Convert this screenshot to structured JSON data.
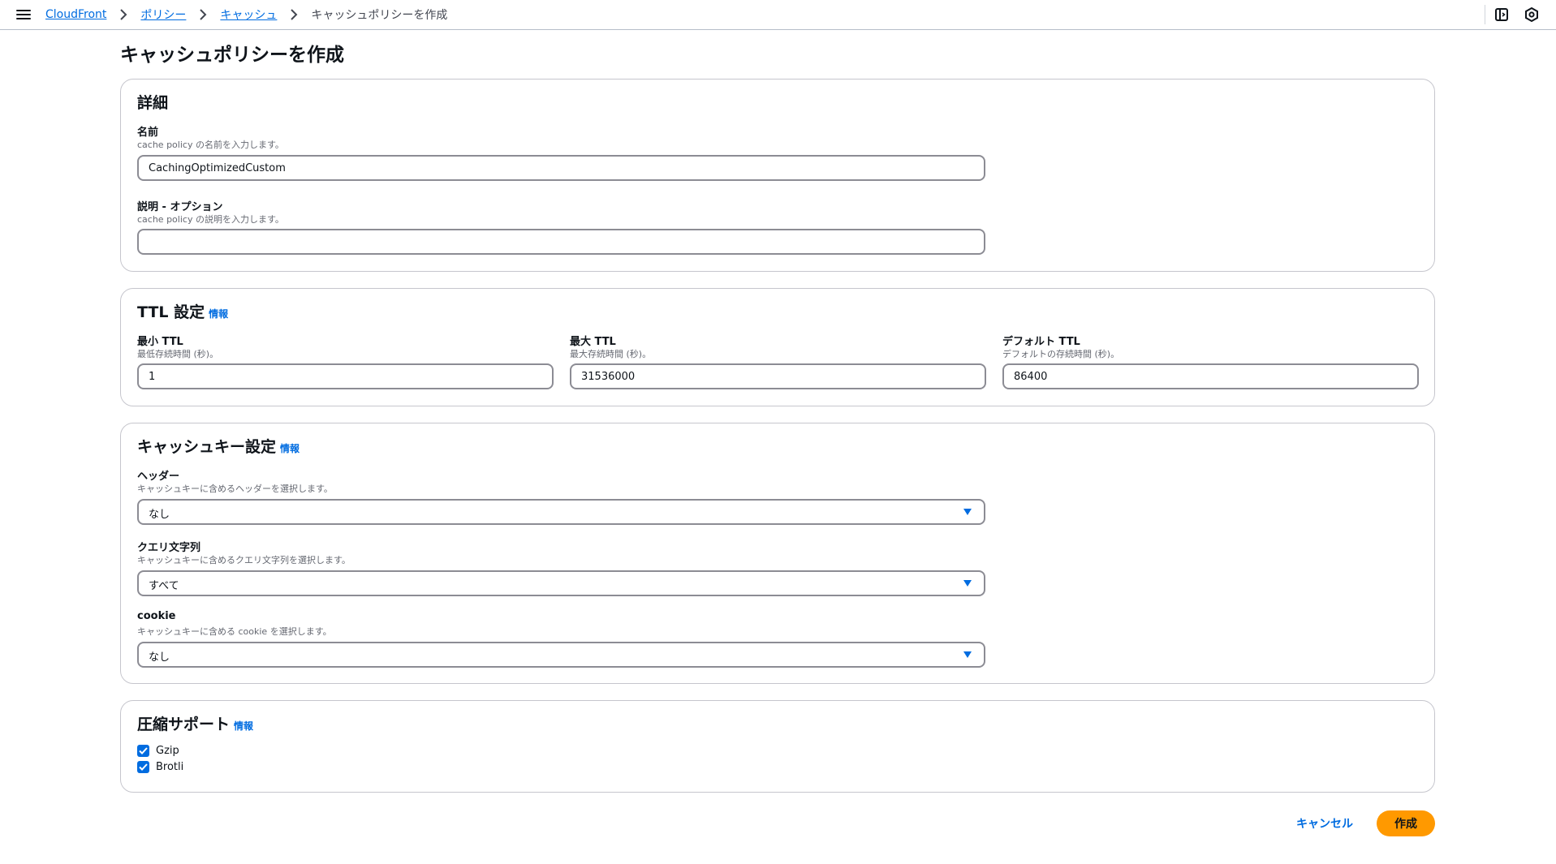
{
  "breadcrumb": {
    "items": [
      "CloudFront",
      "ポリシー",
      "キャッシュ"
    ],
    "current": "キャッシュポリシーを作成"
  },
  "page_title": "キャッシュポリシーを作成",
  "details": {
    "heading": "詳細",
    "name_label": "名前",
    "name_desc": "cache policy の名前を入力します。",
    "name_value": "CachingOptimizedCustom",
    "description_label": "説明 - オプション",
    "description_desc": "cache policy の説明を入力します。",
    "description_value": ""
  },
  "ttl": {
    "heading": "TTL 設定",
    "info": "情報",
    "min_label": "最小 TTL",
    "min_desc": "最低存続時間 (秒)。",
    "min_value": "1",
    "max_label": "最大 TTL",
    "max_desc": "最大存続時間 (秒)。",
    "max_value": "31536000",
    "default_label": "デフォルト TTL",
    "default_desc": "デフォルトの存続時間 (秒)。",
    "default_value": "86400"
  },
  "cache_key": {
    "heading": "キャッシュキー設定",
    "info": "情報",
    "headers_label": "ヘッダー",
    "headers_desc": "キャッシュキーに含めるヘッダーを選択します。",
    "headers_value": "なし",
    "query_label": "クエリ文字列",
    "query_desc": "キャッシュキーに含めるクエリ文字列を選択します。",
    "query_value": "すべて",
    "cookie_label": "cookie",
    "cookie_desc": "キャッシュキーに含める cookie を選択します。",
    "cookie_value": "なし"
  },
  "compression": {
    "heading": "圧縮サポート",
    "info": "情報",
    "gzip": "Gzip",
    "gzip_checked": true,
    "brotli": "Brotli",
    "brotli_checked": true
  },
  "actions": {
    "cancel": "キャンセル",
    "create": "作成"
  },
  "colors": {
    "accent": "#006ce0",
    "primary_button": "#ff9900",
    "border": "#c6c6cd"
  }
}
